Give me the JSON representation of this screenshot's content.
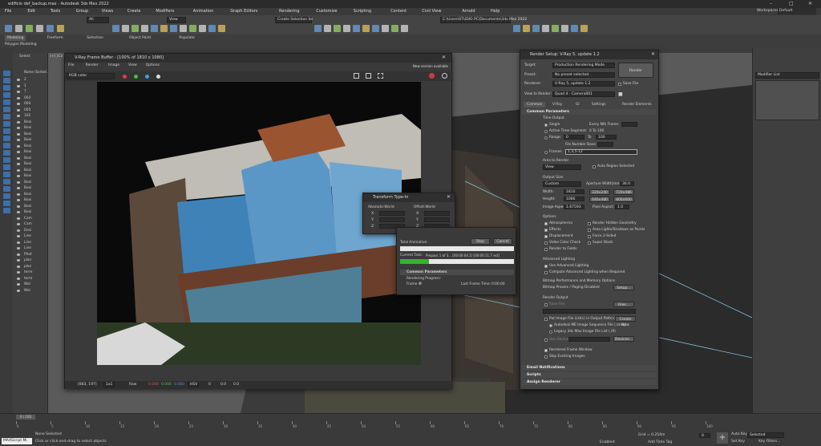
{
  "window": {
    "title": "edificio def_backup.max - Autodesk 3ds Max 2022",
    "workspace_label": "Workspaces:",
    "workspace_value": "Default"
  },
  "menu": [
    "File",
    "Edit",
    "Tools",
    "Group",
    "Views",
    "Create",
    "Modifiers",
    "Animation",
    "Graph Editors",
    "Rendering",
    "Customize",
    "Scripting",
    "Content",
    "Civil View",
    "Arnold",
    "Help"
  ],
  "toolbar": {
    "selection_filter": "All",
    "view_dropdown": "View",
    "create_selection_set": "Create Selection Se",
    "project_path": "C:\\Users\\STUDIO PC\\Documents\\3ds Max 2022"
  },
  "ribbon": {
    "tabs": [
      "Modeling",
      "Freeform",
      "Selection",
      "Object Paint",
      "Populate"
    ],
    "sub": "Polygon Modeling"
  },
  "scene_explorer": {
    "header": "Select",
    "column": "Name (Sorted ...)",
    "items": [
      "2",
      "1",
      "7",
      "003",
      "004",
      "005",
      "102",
      "Boxi",
      "Boxi",
      "Boxi",
      "Boxi",
      "Boxi",
      "Boxi",
      "Boxi",
      "Boxi",
      "Boxi",
      "Boxi",
      "Boxi",
      "Boxi",
      "Boxi",
      "Boxi",
      "Boxi",
      "Boxi",
      "Cam",
      "Cam",
      "Desi",
      "Line",
      "Line",
      "Line",
      "Phot",
      "plan",
      "plan",
      "terre",
      "terre",
      "Wal",
      "Wal"
    ]
  },
  "viewport": {
    "label": "[+] [Ca"
  },
  "vfb": {
    "title": "V-Ray Frame Buffer - [100% of 1810 x 1080]",
    "menu": [
      "File",
      "Render",
      "Image",
      "View",
      "Options"
    ],
    "notice": "New version available",
    "channel": "RGB color",
    "status": {
      "coords": "[883, 197]",
      "mode": "1x1",
      "raw": "Raw",
      "r": "0.000",
      "g": "0.000",
      "b": "0.000",
      "space": "HSV",
      "h": "0",
      "s": "0.0",
      "v": "0.0"
    }
  },
  "transform": {
    "title": "Transform Type-In",
    "absolute": "Absolute:World",
    "offset": "Offset:World",
    "axes": [
      "X:",
      "Y:",
      "Z:"
    ]
  },
  "progress": {
    "total_label": "Total Animation:",
    "current_label": "Current Task:",
    "current_task": "Prepass 1 of 3... [00:00:04.1] [00:00:11.7 est]",
    "stop": "Stop",
    "cancel": "Cancel",
    "section": "Common Parameters",
    "rendering_progress": "Rendering Progress:",
    "frame_label": "Frame #",
    "frame_value": "0",
    "last_frame_label": "Last Frame Time:",
    "last_frame_value": "0:00:00",
    "current_fraction": 0.25
  },
  "render_setup": {
    "title": "Render Setup: V-Ray 5, update 1.2",
    "target_label": "Target:",
    "target_value": "Production Rendering Mode",
    "preset_label": "Preset:",
    "preset_value": "No preset selected",
    "renderer_label": "Renderer:",
    "renderer_value": "V-Ray 5, update 1.2",
    "save_file": "Save File",
    "view_label": "View to Render:",
    "view_value": "Quad 4 - Camera001",
    "render_button": "Render",
    "tabs": [
      "Common",
      "V-Ray",
      "GI",
      "Settings",
      "Render Elements"
    ],
    "common_params": "Common Parameters",
    "time_output": "Time Output",
    "single": "Single",
    "every_nth": "Every Nth Frame:",
    "active_segment": "Active Time Segment:",
    "active_range": "0 To 100",
    "range": "Range:",
    "range_from": "0",
    "range_to_label": "To",
    "range_to": "100",
    "file_number_base": "File Number Base:",
    "frames": "Frames",
    "frames_value": "1,3,5-12",
    "area_to_render": "Area to Render",
    "area_value": "View",
    "auto_region": "Auto Region Selected",
    "output_size": "Output Size",
    "output_preset": "Custom",
    "aperture_label": "Aperture Width(mm):",
    "aperture_value": "36.0",
    "width_label": "Width:",
    "width_value": "1810",
    "height_label": "Height:",
    "height_value": "1080",
    "sizes": [
      "320x240",
      "720x486",
      "640x480",
      "800x600"
    ],
    "image_aspect_label": "Image Aspect:",
    "image_aspect_value": "1.67593",
    "pixel_aspect_label": "Pixel Aspect:",
    "pixel_aspect_value": "1.0",
    "options": "Options",
    "opts_left": [
      "Atmospherics",
      "Effects",
      "Displacement",
      "Video Color Check",
      "Render to Fields"
    ],
    "opts_right": [
      "Render Hidden Geometry",
      "Area Lights/Shadows as Points",
      "Force 2-Sided",
      "Super Black"
    ],
    "advanced_lighting": "Advanced Lighting",
    "use_advanced": "Use Advanced Lighting",
    "compute_advanced": "Compute Advanced Lighting when Required",
    "bitmap_perf": "Bitmap Performance and Memory Options",
    "bitmap_proxies": "Bitmap Proxies / Paging Disabled",
    "setup": "Setup...",
    "render_output": "Render Output",
    "save_file2": "Save File",
    "files": "Files...",
    "put_image": "Put Image File List(s) in Output Path(s)",
    "create_now": "Create Now",
    "autodesk_seq": "Autodesk ME Image Sequence File (.imsq)",
    "legacy_seq": "Legacy 3ds Max Image File List (.ifl)",
    "use_device": "Use Device",
    "devices": "Devices...",
    "rendered_frame_window": "Rendered Frame Window",
    "skip_existing": "Skip Existing Images",
    "rollouts": [
      "Email Notifications",
      "Scripts",
      "Assign Renderer"
    ]
  },
  "command_panel": {
    "modifier_list": "Modifier List"
  },
  "timeline": {
    "frame": "0 / 100",
    "ticks": [
      "0",
      "5",
      "10",
      "15",
      "20",
      "25",
      "30",
      "35",
      "40",
      "45",
      "50",
      "55",
      "60",
      "65",
      "70",
      "75",
      "80",
      "85",
      "90",
      "95",
      "100"
    ]
  },
  "status_bar": {
    "script": "MAXScript Mi",
    "selection": "None Selected",
    "prompt": "Click or click-and-drag to select objects",
    "grid": "Grid = 0.254m",
    "add_time_tag": "Add Time Tag",
    "auto_key": "Auto Key",
    "set_key": "Set Key",
    "selected": "Selected",
    "key_filters": "Key Filters...",
    "enabled": "Enabled:",
    "frame_field": "0"
  }
}
